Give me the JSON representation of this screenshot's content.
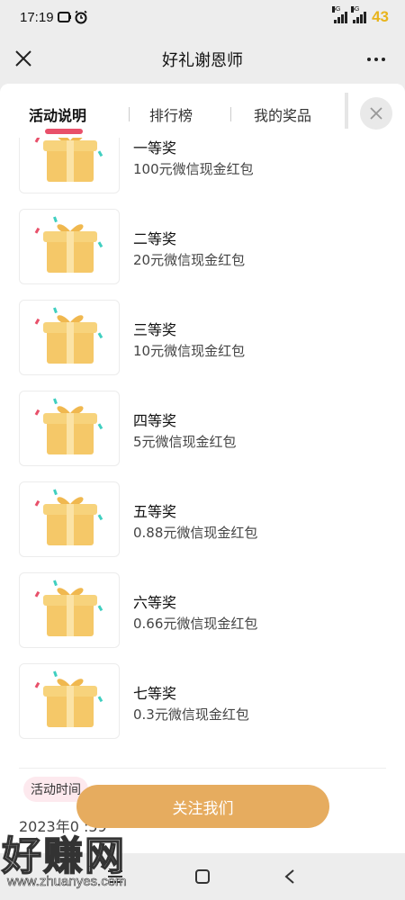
{
  "status": {
    "time": "17:19",
    "battery": "43",
    "net1": "5G",
    "net2": "5G"
  },
  "header": {
    "title": "好礼谢恩师"
  },
  "tabs": [
    {
      "label": "活动说明",
      "active": true
    },
    {
      "label": "排行榜",
      "active": false
    },
    {
      "label": "我的奖品",
      "active": false
    }
  ],
  "prizes": [
    {
      "name": "一等奖",
      "desc": "100元微信现金红包"
    },
    {
      "name": "二等奖",
      "desc": "20元微信现金红包"
    },
    {
      "name": "三等奖",
      "desc": "10元微信现金红包"
    },
    {
      "name": "四等奖",
      "desc": "5元微信现金红包"
    },
    {
      "name": "五等奖",
      "desc": "0.88元微信现金红包"
    },
    {
      "name": "六等奖",
      "desc": "0.66元微信现金红包"
    },
    {
      "name": "七等奖",
      "desc": "0.3元微信现金红包"
    }
  ],
  "section": {
    "time_label": "活动时间",
    "time_text_partial": "2023年0                              :59"
  },
  "footer": {
    "follow_label": "关注我们"
  },
  "watermark": {
    "big": "好赚网",
    "small": "www.zhuanyes.com"
  },
  "colors": {
    "accent": "#e6ac5f",
    "tab_underline": "#e8506a",
    "battery": "#e8b41c"
  },
  "icons": [
    "close-icon",
    "more-icon",
    "gift-icon",
    "home-icon",
    "back-icon",
    "alarm-icon"
  ]
}
